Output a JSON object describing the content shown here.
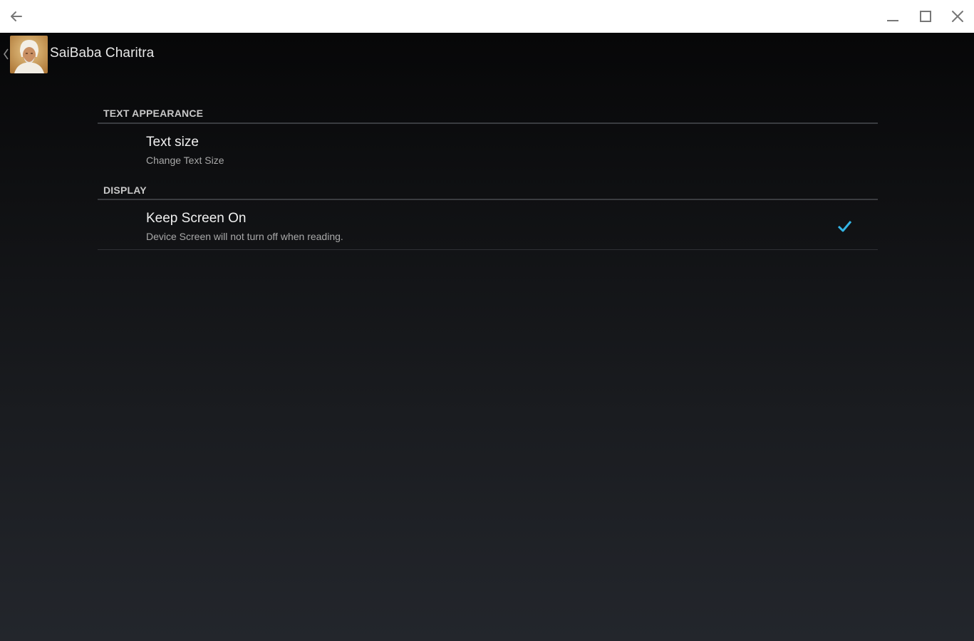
{
  "window": {
    "back_icon": "arrow-left-icon",
    "minimize_icon": "minimize-icon",
    "maximize_icon": "maximize-icon",
    "close_icon": "close-icon"
  },
  "actionbar": {
    "title": "SaiBaba Charitra",
    "up_icon": "chevron-left-icon",
    "app_icon": "saibaba-portrait-icon"
  },
  "preferences": {
    "categories": [
      {
        "title": "TEXT APPEARANCE",
        "items": [
          {
            "title": "Text size",
            "summary": "Change Text Size"
          }
        ]
      },
      {
        "title": "DISPLAY",
        "items": [
          {
            "title": "Keep Screen On",
            "summary": "Device Screen will not turn off when reading.",
            "checked": true
          }
        ]
      }
    ]
  },
  "colors": {
    "accent": "#33b5e5",
    "titlebar": "#ffffff",
    "background_top": "#050506",
    "background_bottom": "#23262c"
  }
}
